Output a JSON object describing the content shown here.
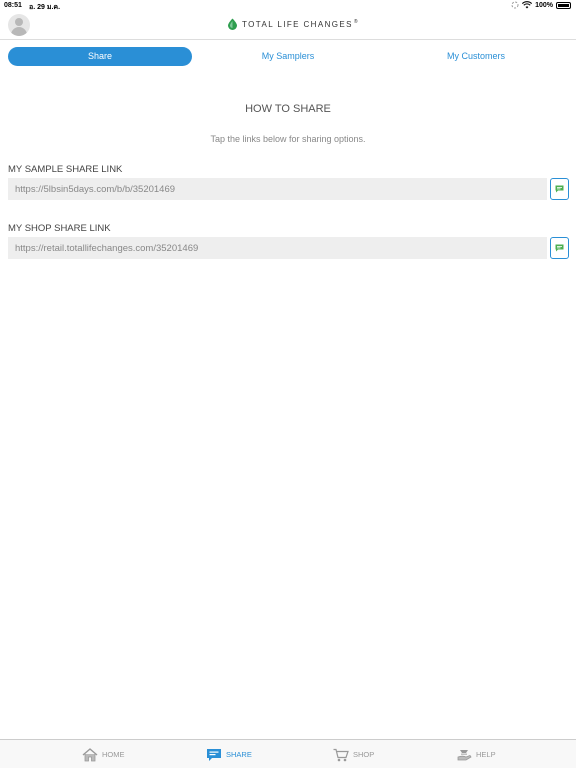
{
  "status_bar": {
    "time": "08:51",
    "date": "อ. 29 ม.ค.",
    "battery": "100%"
  },
  "brand": {
    "name": "TOTAL LIFE CHANGES",
    "mark": "®"
  },
  "segments": [
    {
      "label": "Share",
      "active": true
    },
    {
      "label": "My Samplers",
      "active": false
    },
    {
      "label": "My Customers",
      "active": false
    }
  ],
  "share": {
    "heading": "HOW TO SHARE",
    "subtext": "Tap the links below for sharing options.",
    "sample_link": {
      "label": "MY SAMPLE SHARE LINK",
      "value": "https://5lbsin5days.com/b/b/35201469"
    },
    "shop_link": {
      "label": "MY SHOP SHARE LINK",
      "value": "https://retail.totallifechanges.com/35201469"
    }
  },
  "tabs": [
    {
      "label": "HOME",
      "icon": "house-icon",
      "active": false
    },
    {
      "label": "SHARE",
      "icon": "chat-bubble-icon",
      "active": true
    },
    {
      "label": "SHOP",
      "icon": "cart-icon",
      "active": false
    },
    {
      "label": "HELP",
      "icon": "helping-hand-icon",
      "active": false
    }
  ],
  "colors": {
    "accent": "#2a8fd6",
    "field_bg": "#eeeeee",
    "sms_icon": "#4caf50",
    "brand_green": "#2e9e4f"
  }
}
